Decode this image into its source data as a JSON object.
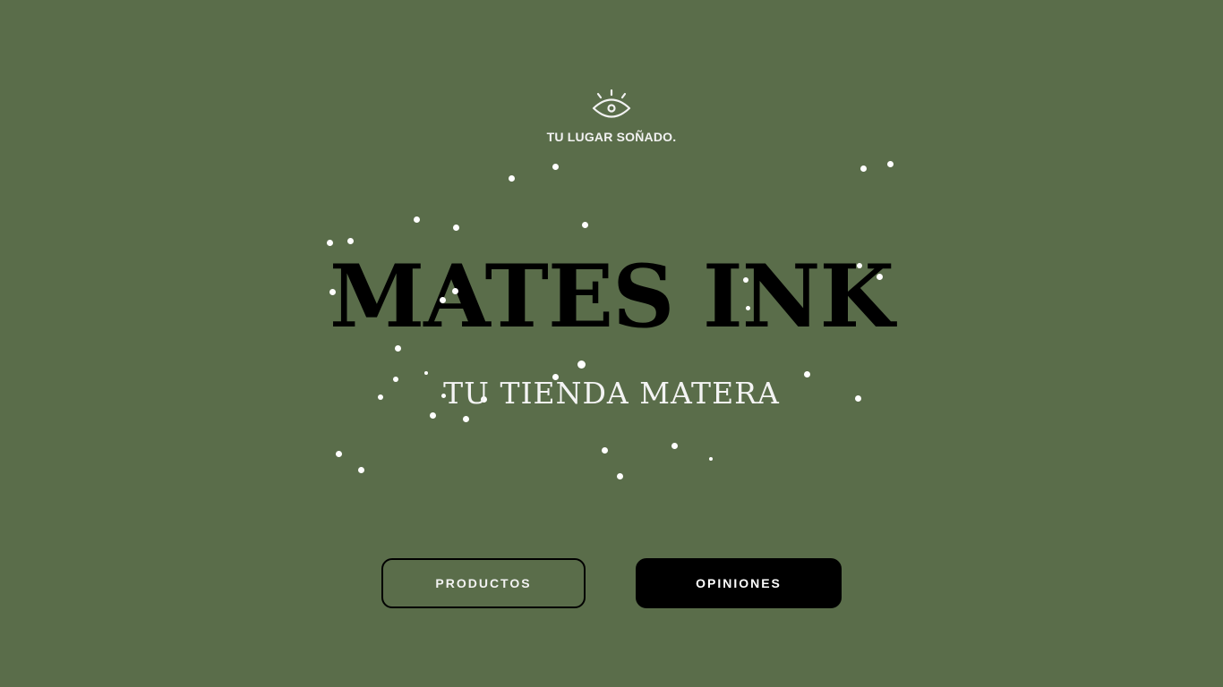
{
  "hero": {
    "tagline": "TU LUGAR SOÑADO.",
    "title": "MATES INK",
    "subtitle": "TU TIENDA MATERA",
    "icon": "eye-icon"
  },
  "buttons": {
    "products_label": "PRODUCTOS",
    "reviews_label": "OPINIONES"
  },
  "colors": {
    "background": "#5a6d4a",
    "title": "#000000",
    "text_light": "#f2f2f2",
    "button_dark": "#000000"
  }
}
